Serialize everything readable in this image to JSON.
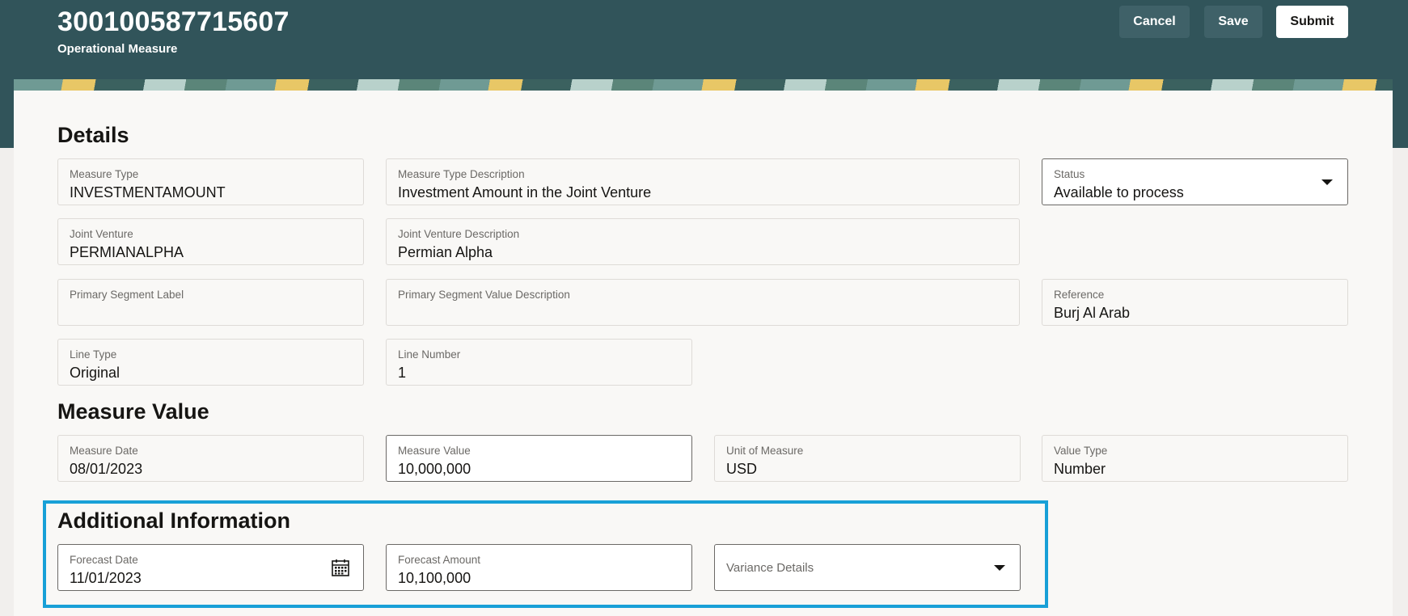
{
  "header": {
    "title": "300100587715607",
    "subtitle": "Operational Measure",
    "buttons": {
      "cancel": "Cancel",
      "save": "Save",
      "submit": "Submit"
    }
  },
  "details": {
    "heading": "Details",
    "measure_type": {
      "label": "Measure Type",
      "value": "INVESTMENTAMOUNT"
    },
    "measure_type_description": {
      "label": "Measure Type Description",
      "value": "Investment Amount in the Joint Venture"
    },
    "status": {
      "label": "Status",
      "value": "Available to process"
    },
    "joint_venture": {
      "label": "Joint Venture",
      "value": "PERMIANALPHA"
    },
    "joint_venture_description": {
      "label": "Joint Venture Description",
      "value": "Permian Alpha"
    },
    "primary_segment_label": {
      "label": "Primary Segment Label",
      "value": ""
    },
    "primary_segment_value_description": {
      "label": "Primary Segment Value Description",
      "value": ""
    },
    "reference": {
      "label": "Reference",
      "value": "Burj Al Arab"
    },
    "line_type": {
      "label": "Line Type",
      "value": "Original"
    },
    "line_number": {
      "label": "Line Number",
      "value": "1"
    }
  },
  "measure_value": {
    "heading": "Measure Value",
    "measure_date": {
      "label": "Measure Date",
      "value": "08/01/2023"
    },
    "measure_value": {
      "label": "Measure Value",
      "value": "10,000,000"
    },
    "unit_of_measure": {
      "label": "Unit of Measure",
      "value": "USD"
    },
    "value_type": {
      "label": "Value Type",
      "value": "Number"
    }
  },
  "additional_information": {
    "heading": "Additional Information",
    "forecast_date": {
      "label": "Forecast Date",
      "value": "11/01/2023"
    },
    "forecast_amount": {
      "label": "Forecast Amount",
      "value": "10,100,000"
    },
    "variance_details": {
      "placeholder": "Variance Details"
    }
  },
  "colors": {
    "header_bg": "#31545a",
    "highlight_border": "#18a0d7",
    "panel_bg": "#f9f8f6"
  }
}
